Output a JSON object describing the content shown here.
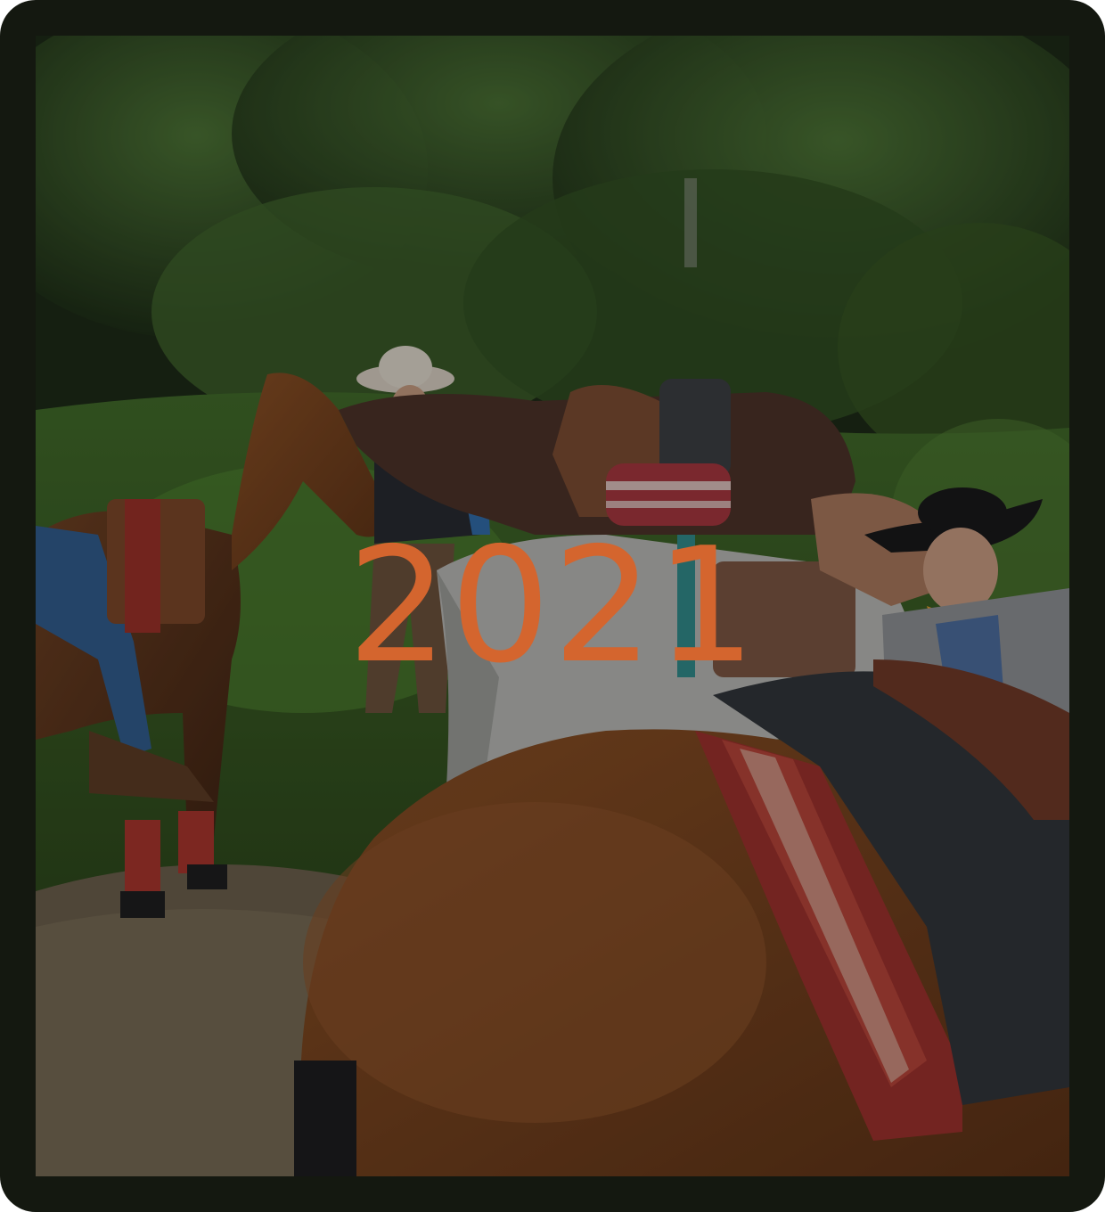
{
  "card": {
    "year_label": "2021",
    "accent_color": "#d4652e",
    "frame_color": "#141810"
  }
}
